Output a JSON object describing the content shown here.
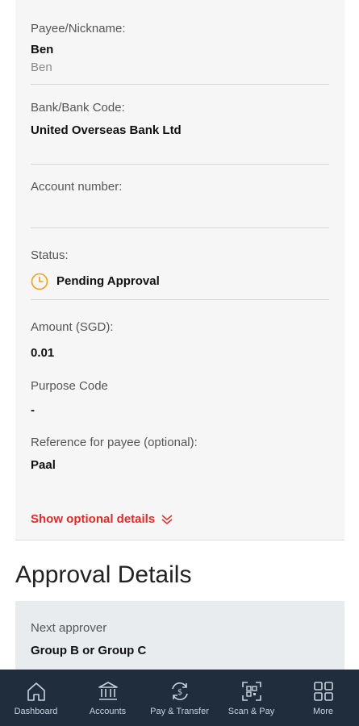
{
  "details": {
    "payee_label": "Payee/Nickname:",
    "payee_name": "Ben",
    "payee_nickname": "Ben",
    "bank_label": "Bank/Bank Code:",
    "bank_value": "United Overseas Bank Ltd",
    "account_label": "Account number:",
    "account_value": "",
    "status_label": "Status:",
    "status_value": "Pending Approval",
    "amount_label": "Amount (SGD):",
    "amount_value": "0.01",
    "purpose_label": "Purpose Code",
    "purpose_value": "-",
    "reference_label": "Reference for payee (optional):",
    "reference_value": "Paal",
    "optional_link": "Show optional details"
  },
  "approval": {
    "title": "Approval Details",
    "next_label": "Next approver",
    "next_value": "Group B or Group C"
  },
  "tabbar": {
    "items": [
      {
        "label": "Dashboard",
        "icon": "home-icon"
      },
      {
        "label": "Accounts",
        "icon": "bank-icon"
      },
      {
        "label": "Pay & Transfer",
        "icon": "transfer-icon"
      },
      {
        "label": "Scan & Pay",
        "icon": "qr-icon"
      },
      {
        "label": "More",
        "icon": "grid-icon"
      }
    ]
  },
  "colors": {
    "accent": "#e02b2b",
    "status_icon": "#f0a020",
    "tabbar_bg": "#1f2d3d"
  }
}
